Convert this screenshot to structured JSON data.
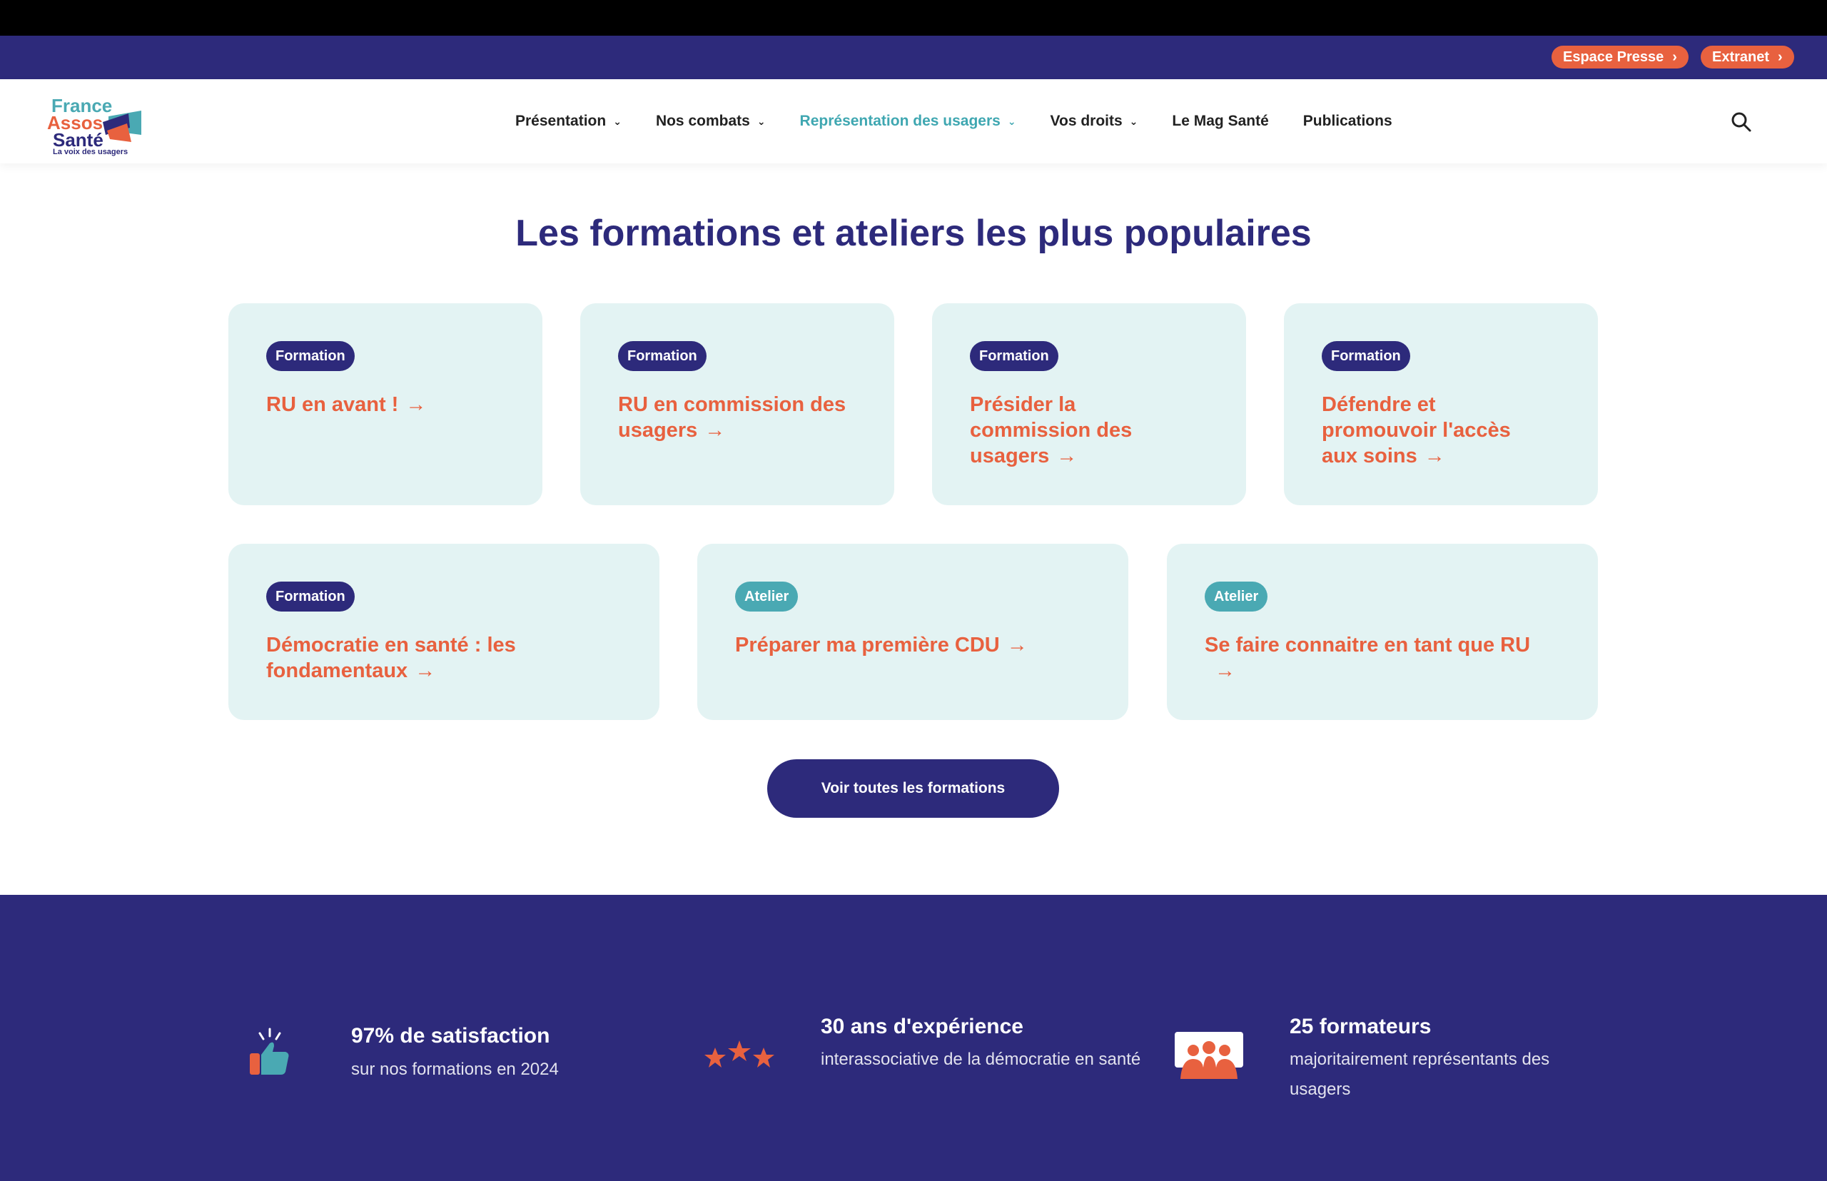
{
  "utility": {
    "press_label": "Espace Presse",
    "extranet_label": "Extranet"
  },
  "logo": {
    "line1": "France",
    "line2": "Assos",
    "line3": "Santé",
    "tagline": "La voix des usagers"
  },
  "nav": {
    "items": [
      {
        "label": "Présentation",
        "dropdown": true
      },
      {
        "label": "Nos combats",
        "dropdown": true
      },
      {
        "label": "Représentation des usagers",
        "dropdown": true,
        "active": true
      },
      {
        "label": "Vos droits",
        "dropdown": true
      },
      {
        "label": "Le Mag Santé",
        "dropdown": false
      },
      {
        "label": "Publications",
        "dropdown": false
      }
    ],
    "search_icon": "search-icon"
  },
  "main": {
    "title": "Les formations et ateliers les plus populaires",
    "cards": [
      {
        "badge": "Formation",
        "title": "RU en avant !"
      },
      {
        "badge": "Formation",
        "title": "RU en commission des usagers"
      },
      {
        "badge": "Formation",
        "title": "Présider la commission des usagers"
      },
      {
        "badge": "Formation",
        "title": "Défendre et promouvoir l'accès aux soins"
      },
      {
        "badge": "Formation",
        "title": "Démocratie en santé : les fondamentaux"
      },
      {
        "badge": "Atelier",
        "title": "Préparer ma première CDU"
      },
      {
        "badge": "Atelier",
        "title": "Se faire connaitre en tant que RU"
      }
    ],
    "cta_label": "Voir toutes les formations"
  },
  "stats": [
    {
      "icon": "thumbs-up-icon",
      "title": "97% de satisfaction",
      "subtitle": "sur nos formations en 2024"
    },
    {
      "icon": "three-stars-icon",
      "title": "30 ans d'expérience",
      "subtitle": "interassociative de la démocratie en santé"
    },
    {
      "icon": "group-people-icon",
      "title": "25 formateurs",
      "subtitle": "majoritairement représentants des usagers"
    }
  ],
  "colors": {
    "brand_navy": "#2d2a7b",
    "accent_orange": "#e8613f",
    "accent_teal": "#3fa7b1",
    "card_bg": "#e3f3f3"
  }
}
